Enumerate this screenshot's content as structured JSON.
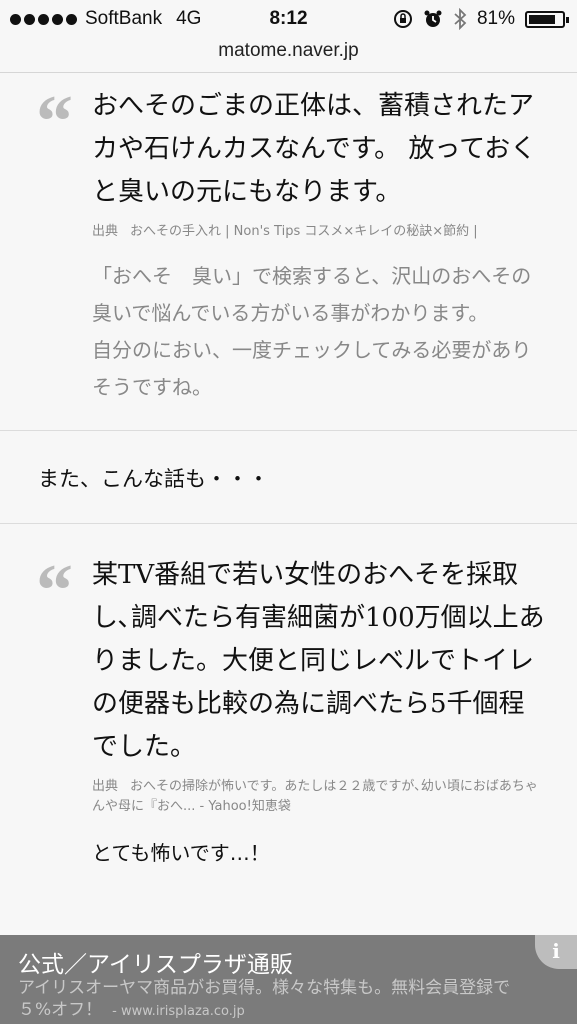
{
  "status_bar": {
    "carrier": "SoftBank",
    "network": "4G",
    "time": "8:12",
    "battery": "81%",
    "battery_level": 0.81
  },
  "browser": {
    "url": "matome.naver.jp"
  },
  "quote1": {
    "text": "おへそのごまの正体は、蓄積されたアカや石けんカスなんです。 放っておくと臭いの元にもなります。",
    "source_label": "出典",
    "source_text": "おへその手入れ | Non's Tips コスメ×キレイの秘訣×節約 |"
  },
  "comment1": "「おへそ　臭い」で検索すると、沢山のおへその臭いで悩んでいる方がいる事がわかります。\n自分のにおい、一度チェックしてみる必要がありそうですね。",
  "lead": "また、こんな話も・・・",
  "quote2": {
    "text": "某TV番組で若い女性のおへそを採取し､調べたら有害細菌が100万個以上ありました。大便と同じレベルでトイレの便器も比較の為に調べたら5千個程でした。",
    "source_label": "出典",
    "source_text": "おへその掃除が怖いです。あたしは２２歳ですが､幼い頃におばあちゃんや母に『おへ... - Yahoo!知恵袋"
  },
  "comment2": "とても怖いです…！",
  "ad": {
    "title": "公式／アイリスプラザ通販",
    "description": "アイリスオーヤマ商品がお買得。様々な特集も。無料会員登録で５%オフ！",
    "link": "- www.irisplaza.co.jp",
    "info_label": "i"
  },
  "icons": {
    "signal": "signal-dots-icon",
    "lock_rotation": "rotation-lock-icon",
    "alarm": "alarm-icon",
    "bluetooth": "bluetooth-icon",
    "battery": "battery-icon",
    "quote": "quote-mark-icon"
  }
}
